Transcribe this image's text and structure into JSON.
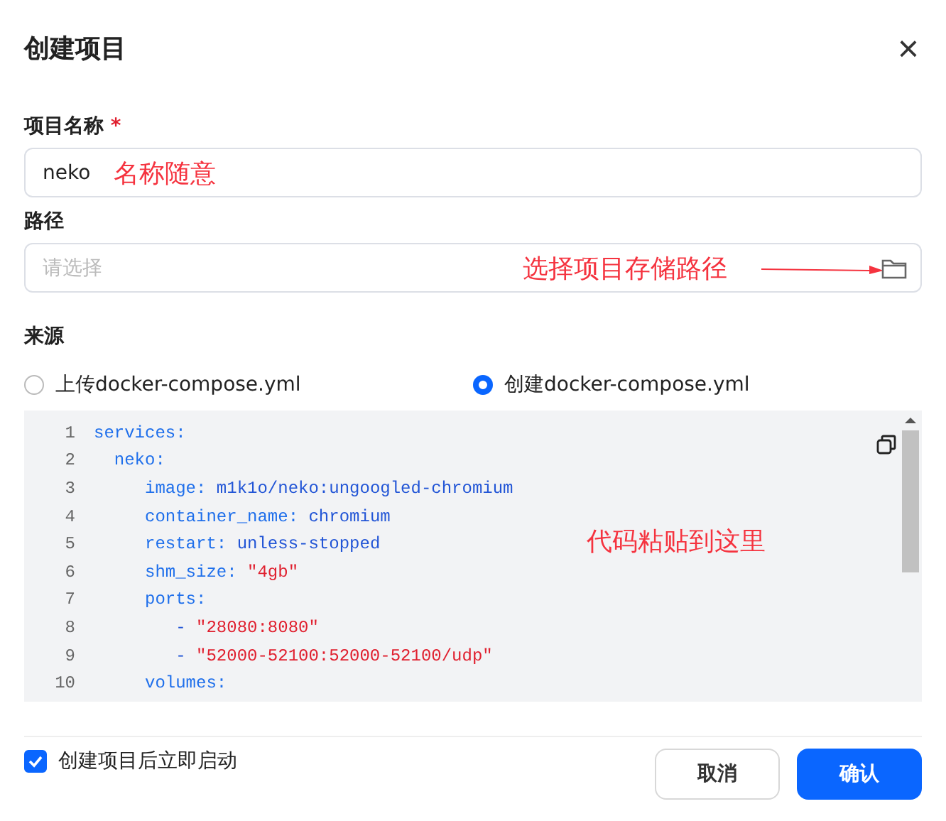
{
  "dialog": {
    "title": "创建项目",
    "close": "×"
  },
  "name_field": {
    "label": "项目名称",
    "required_mark": "*",
    "value": "neko",
    "annotation": "名称随意"
  },
  "path_field": {
    "label": "路径",
    "placeholder": "请选择",
    "annotation": "选择项目存储路径"
  },
  "source": {
    "label": "来源",
    "options": [
      {
        "label": "上传docker-compose.yml",
        "selected": false
      },
      {
        "label": "创建docker-compose.yml",
        "selected": true
      }
    ]
  },
  "editor": {
    "annotation": "代码粘贴到这里",
    "lines": [
      {
        "number": "1",
        "segments": [
          {
            "kind": "key",
            "text": "services:"
          }
        ]
      },
      {
        "number": "2",
        "segments": [
          {
            "kind": "key",
            "text": "  neko:"
          }
        ]
      },
      {
        "number": "3",
        "segments": [
          {
            "kind": "key",
            "text": "     image:"
          },
          {
            "kind": "value",
            "text": " m1k1o/neko:ungoogled-chromium"
          }
        ]
      },
      {
        "number": "4",
        "segments": [
          {
            "kind": "key",
            "text": "     container_name:"
          },
          {
            "kind": "value",
            "text": " chromium"
          }
        ]
      },
      {
        "number": "5",
        "segments": [
          {
            "kind": "key",
            "text": "     restart:"
          },
          {
            "kind": "value",
            "text": " unless-stopped"
          }
        ]
      },
      {
        "number": "6",
        "segments": [
          {
            "kind": "key",
            "text": "     shm_size:"
          },
          {
            "kind": "string",
            "text": " \"4gb\""
          }
        ]
      },
      {
        "number": "7",
        "segments": [
          {
            "kind": "key",
            "text": "     ports:"
          }
        ]
      },
      {
        "number": "8",
        "segments": [
          {
            "kind": "value",
            "text": "        - "
          },
          {
            "kind": "string",
            "text": "\"28080:8080\""
          }
        ]
      },
      {
        "number": "9",
        "segments": [
          {
            "kind": "value",
            "text": "        - "
          },
          {
            "kind": "string",
            "text": "\"52000-52100:52000-52100/udp\""
          }
        ]
      },
      {
        "number": "10",
        "segments": [
          {
            "kind": "key",
            "text": "     volumes:"
          }
        ]
      }
    ]
  },
  "start_after_create": {
    "label": "创建项目后立即启动",
    "checked": true
  },
  "buttons": [
    {
      "label": "取消",
      "kind": "secondary"
    },
    {
      "label": "确认",
      "kind": "primary"
    }
  ]
}
